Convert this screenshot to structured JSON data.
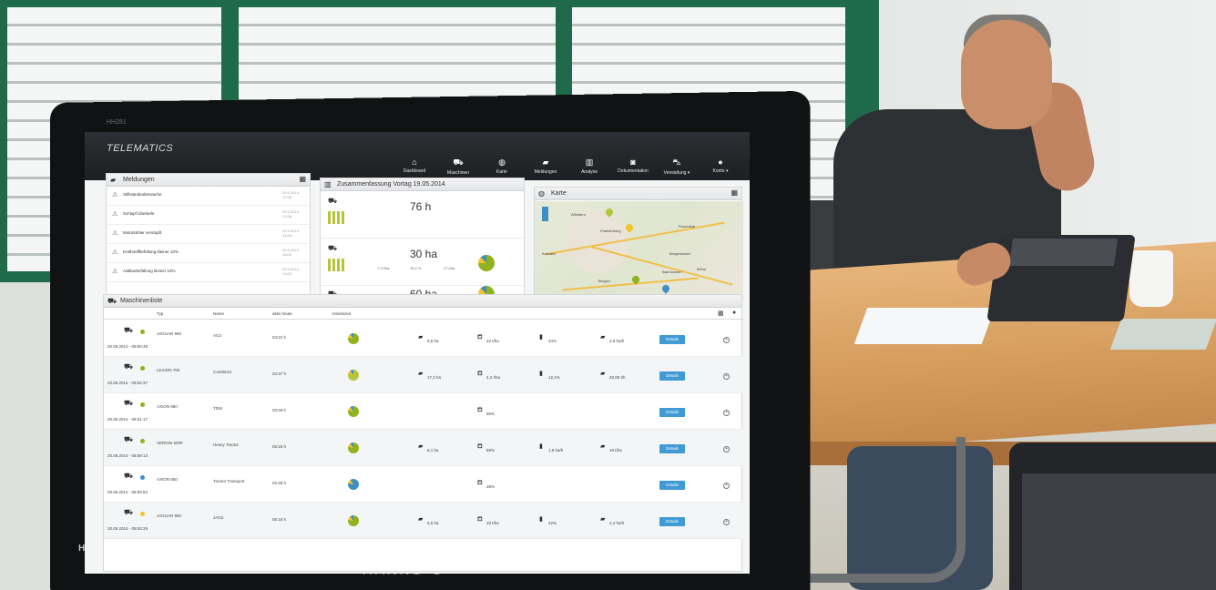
{
  "monitor": {
    "model": "HH281",
    "port_label": "HDMI",
    "brand": "HANNS·G"
  },
  "app": {
    "title": "TELEMATICS",
    "nav": [
      {
        "label": "Dashboard",
        "icon": "home-icon",
        "glyph": "⌂"
      },
      {
        "label": "Maschinen",
        "icon": "tractor-icon",
        "glyph": "⛟"
      },
      {
        "label": "Karte",
        "icon": "globe-icon",
        "glyph": "◍"
      },
      {
        "label": "Meldungen",
        "icon": "folder-icon",
        "glyph": "▰"
      },
      {
        "label": "Analyse",
        "icon": "chart-icon",
        "glyph": "▥"
      },
      {
        "label": "Dokumentation",
        "icon": "camera-icon",
        "glyph": "◙"
      },
      {
        "label": "Verwaltung ▾",
        "icon": "car-icon",
        "glyph": "⛍"
      },
      {
        "label": "Konto ▾",
        "icon": "user-icon",
        "glyph": "●"
      }
    ]
  },
  "messages": {
    "title": "Meldungen",
    "items": [
      {
        "text": "Stillstandsüberwache",
        "time": "20.5.2014 17:06"
      },
      {
        "text": "Schlupf Überkehr",
        "time": "20.5.2014 17:08"
      },
      {
        "text": "Motorkühler verstopft",
        "time": "20.5.2014 14:08"
      },
      {
        "text": "Kraftstoffbefüllung kleiner 10%",
        "time": "20.5.2014 13:05"
      },
      {
        "text": "AdBluebefüllung kleiner 10%",
        "time": "20.5.2014 13:00"
      }
    ]
  },
  "summary": {
    "title": "Zusammenfassung Vortag 19.05.2014",
    "rows": [
      {
        "big": "76 h",
        "small": []
      },
      {
        "big": "30 ha",
        "small": [
          "7,9 t/ha",
          "15,4 %",
          "27 t/ha"
        ]
      },
      {
        "big": "60 ha",
        "small": []
      }
    ]
  },
  "map": {
    "title": "Karte",
    "places": [
      "Affoldern",
      "Frankenberg",
      "Korbach",
      "Borgentreich",
      "Rosenthal",
      "Bad Arolsen",
      "Bergen",
      "Brilon"
    ],
    "credit": "© 2013 Nokia © AND © 2014 Microsoft Corporation"
  },
  "machines": {
    "title": "Maschinenliste",
    "columns": [
      "Typ",
      "Name",
      "aktiv heute",
      "Arbeitszeit"
    ],
    "detail_label": "Details",
    "rows": [
      {
        "date": "20.05.2014 - 09:50:48",
        "typ": "JAGUAR 960",
        "name": "AG3",
        "active": "04:21 h",
        "m1": "8,8 ha",
        "m2": "22 t/ha",
        "m3": "34%",
        "m4": "2,6 ha/h",
        "dot": "#8fb21e",
        "pie": "#8fb21e"
      },
      {
        "date": "20.05.2014 - 09:54:37",
        "typ": "LEXION 750",
        "name": "Combine1",
        "active": "04:47 h",
        "m1": "17,2 ha",
        "m2": "4,2 t/ha",
        "m3": "12,1%",
        "m4": "20,05 t/h",
        "dot": "#8fb21e",
        "pie": "#b5c43a"
      },
      {
        "date": "20.05.2014 - 08:51:17",
        "typ": "AXION 950",
        "name": "TDM",
        "active": "03:48 h",
        "m1": "",
        "m2": "85%",
        "m3": "",
        "m4": "",
        "dot": "#8fb21e",
        "pie": "#8fb21e"
      },
      {
        "date": "20.05.2014 - 08:59:13",
        "typ": "XERION 5000",
        "name": "Heavy Tractor",
        "active": "06:19 h",
        "m1": "6,1 ha",
        "m2": "59%",
        "m3": "1,8 ha/h",
        "m4": "18 t/ha",
        "dot": "#8fb21e",
        "pie": "#8fb21e"
      },
      {
        "date": "20.05.2014 - 08:59:53",
        "typ": "AXION 850",
        "name": "Tractor Transport",
        "active": "02:28 h",
        "m1": "",
        "m2": "39%",
        "m3": "",
        "m4": "",
        "dot": "#3d8fc4",
        "pie": "#3d8fc4"
      },
      {
        "date": "20.05.2014 - 09:53:29",
        "typ": "JAGUAR 960",
        "name": "JAG2",
        "active": "05:16 h",
        "m1": "6,5 ha",
        "m2": "20 t/ha",
        "m3": "42%",
        "m4": "2,4 ha/h",
        "dot": "#f0c42d",
        "pie": "#8fb21e"
      }
    ]
  }
}
